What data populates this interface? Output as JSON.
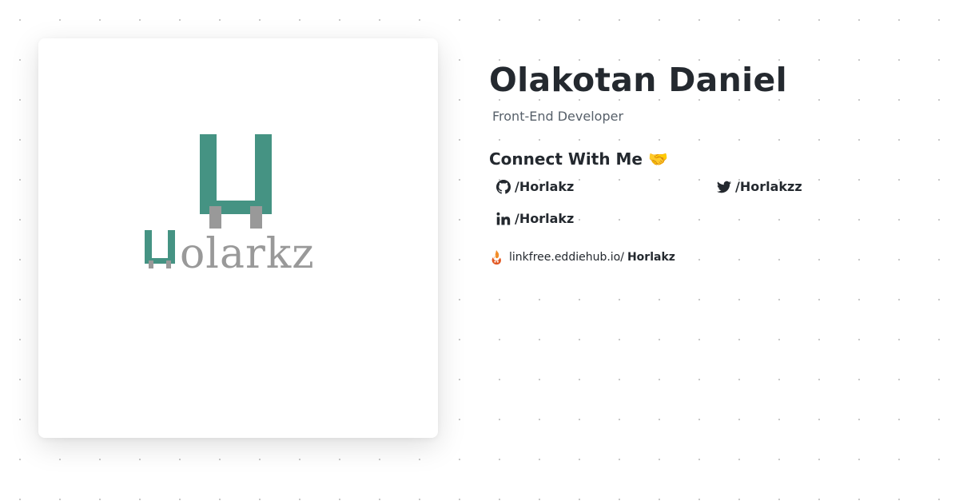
{
  "profile": {
    "name": "Olakotan Daniel",
    "role": "Front-End Developer",
    "logo_text": "Horlarkz"
  },
  "connect": {
    "heading": "Connect With Me 🤝",
    "links": [
      {
        "platform": "GitHub",
        "icon": "github-icon",
        "handle": "/Horlakz"
      },
      {
        "platform": "Twitter",
        "icon": "twitter-icon",
        "handle": "/Horlakzz"
      },
      {
        "platform": "LinkedIn",
        "icon": "linkedin-icon",
        "handle": "/Horlakz"
      }
    ]
  },
  "linkfree": {
    "icon": "linkfree-icon",
    "prefix": "linkfree.eddiehub.io/",
    "username": "Horlakz"
  },
  "colors": {
    "brand_teal": "#459383",
    "logo_gray": "#999999",
    "text": "#24292f",
    "muted": "#57606a"
  }
}
